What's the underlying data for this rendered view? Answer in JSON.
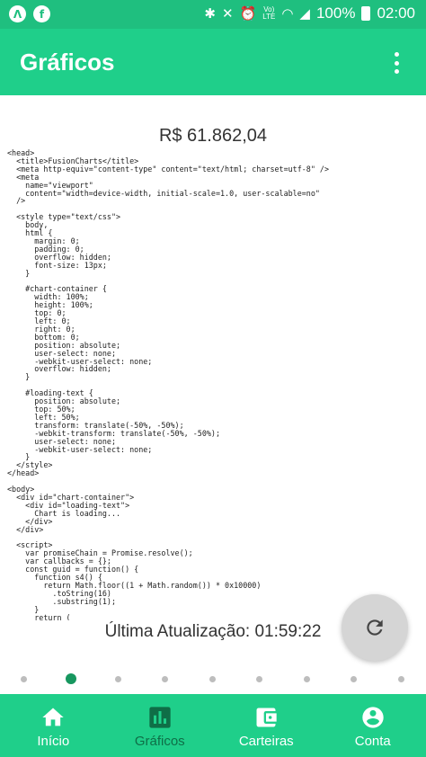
{
  "status_bar": {
    "battery": "100%",
    "time": "02:00",
    "volte": "Vo)\nLTE"
  },
  "app_bar": {
    "title": "Gráficos"
  },
  "main": {
    "price": "R$ 61.862,04",
    "code_snippet": "<head>\n  <title>FusionCharts</title>\n  <meta http-equiv=\"content-type\" content=\"text/html; charset=utf-8\" />\n  <meta\n    name=\"viewport\"\n    content=\"width=device-width, initial-scale=1.0, user-scalable=no\"\n  />\n\n  <style type=\"text/css\">\n    body,\n    html {\n      margin: 0;\n      padding: 0;\n      overflow: hidden;\n      font-size: 13px;\n    }\n\n    #chart-container {\n      width: 100%;\n      height: 100%;\n      top: 0;\n      left: 0;\n      right: 0;\n      bottom: 0;\n      position: absolute;\n      user-select: none;\n      -webkit-user-select: none;\n      overflow: hidden;\n    }\n\n    #loading-text {\n      position: absolute;\n      top: 50%;\n      left: 50%;\n      transform: translate(-50%, -50%);\n      -webkit-transform: translate(-50%, -50%);\n      user-select: none;\n      -webkit-user-select: none;\n    }\n  </style>\n</head>\n\n<body>\n  <div id=\"chart-container\">\n    <div id=\"loading-text\">\n      Chart is loading...\n    </div>\n  </div>\n\n  <script>\n    var promiseChain = Promise.resolve();\n    var callbacks = {};\n    const guid = function() {\n      function s4() {\n        return Math.floor((1 + Math.random()) * 0x10000)\n          .toString(16)\n          .substring(1);\n      }\n      return (",
    "last_update": "Última Atualização: 01:59:22"
  },
  "pager": {
    "count": 9,
    "active_index": 1
  },
  "bottom_nav": {
    "items": [
      {
        "label": "Início",
        "icon": "home-icon"
      },
      {
        "label": "Gráficos",
        "icon": "chart-icon"
      },
      {
        "label": "Carteiras",
        "icon": "wallet-icon"
      },
      {
        "label": "Conta",
        "icon": "account-icon"
      }
    ]
  },
  "colors": {
    "primary": "#1fcf8a",
    "status_bar": "#1fbf7f",
    "active_nav": "#0f6e47",
    "active_dot": "#17975f"
  }
}
